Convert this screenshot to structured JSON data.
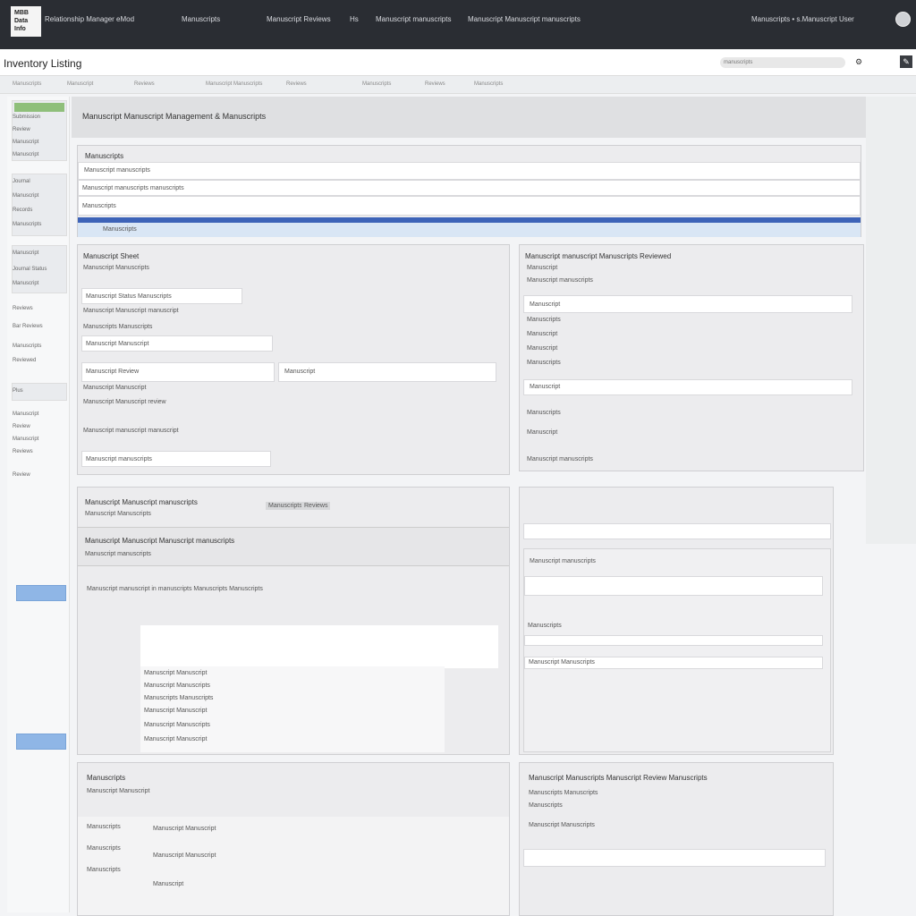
{
  "header": {
    "logo_text": "MBB\nData\nInfo",
    "nav": [
      "Relationship Manager eMod",
      "Manuscripts",
      "Manuscript Reviews",
      "Hs",
      "Manuscript manuscripts",
      "Manuscript Manuscript manuscripts"
    ],
    "user": "Manuscripts  •  s.Manuscript User",
    "page_title": "Inventory Listing",
    "search_placeholder": "manuscripts",
    "tabs": [
      "Manuscripts",
      "Manuscript",
      "Reviews",
      "Manuscript Manuscripts",
      "Reviews",
      "Manuscripts",
      "Reviews",
      "Manuscripts"
    ]
  },
  "sidebar": {
    "items": [
      "Submission",
      "Review",
      "Manuscript",
      "Manuscript",
      "Journal",
      "Manuscript",
      "Records",
      "Manuscripts",
      "Manuscript",
      "Journal Status",
      "Manuscript",
      "Reviews",
      "Bar Reviews",
      "Manuscripts",
      "Reviewed",
      "Plus",
      "Manuscript",
      "Review",
      "Manuscript",
      "Reviews",
      "Review"
    ]
  },
  "main": {
    "title": "Manuscript Manuscript Management & Manuscripts",
    "top_panel": {
      "label": "Manuscripts",
      "rows": [
        "Manuscript manuscripts",
        "Manuscript manuscripts manuscripts",
        "Manuscripts"
      ],
      "bar_label": "Manuscripts"
    },
    "left_form": {
      "title": "Manuscript Sheet",
      "subtitle": "Manuscript Manuscripts",
      "fields": [
        "Manuscript Status Manuscripts",
        "Manuscript Manuscript manuscript",
        "Manuscripts Manuscripts",
        "Manuscript Manuscript",
        "Manuscript Review",
        "Manuscript",
        "Manuscript Manuscript",
        "Manuscript Manuscript review",
        "Manuscript manuscript manuscript",
        "Manuscript manuscripts"
      ]
    },
    "right_panel": {
      "title": "Manuscript manuscript Manuscripts Reviewed",
      "rows": [
        "Manuscript",
        "Manuscript manuscripts",
        "Manuscript",
        "Manuscripts",
        "Manuscript",
        "Manuscript",
        "Manuscripts",
        "Manuscript",
        "Manuscripts",
        "Manuscript"
      ],
      "footer": "Manuscript manuscripts"
    },
    "middle_left": {
      "title": "Manuscript Manuscript manuscripts",
      "subtitle": "Manuscript Manuscripts",
      "buttons": [
        "Manuscripts",
        "Reviews"
      ],
      "section_title": "Manuscript Manuscript Manuscript manuscripts",
      "section_sub": "Manuscript manuscripts",
      "table_title": "Manuscript manuscript in manuscripts Manuscripts Manuscripts",
      "table_rows": [
        "Manuscript Manuscript",
        "Manuscript Manuscripts",
        "Manuscripts Manuscripts",
        "Manuscript Manuscript",
        "Manuscript Manuscripts",
        "Manuscript Manuscript"
      ]
    },
    "middle_right": {
      "title": "Manuscript manuscripts",
      "rows": [
        "Manuscripts",
        "Manuscript Manuscripts",
        "Manuscript Manuscripts"
      ]
    },
    "bottom_left": {
      "title": "Manuscripts",
      "subtitle": "Manuscript Manuscript",
      "rows": [
        "Manuscripts",
        "Manuscript Manuscript",
        "Manuscripts",
        "Manuscript Manuscript",
        "Manuscripts",
        "Manuscript"
      ]
    },
    "bottom_right": {
      "title": "Manuscript Manuscripts Manuscript Review Manuscripts",
      "rows": [
        "Manuscripts Manuscripts",
        "Manuscripts",
        "Manuscript Manuscripts"
      ]
    }
  }
}
